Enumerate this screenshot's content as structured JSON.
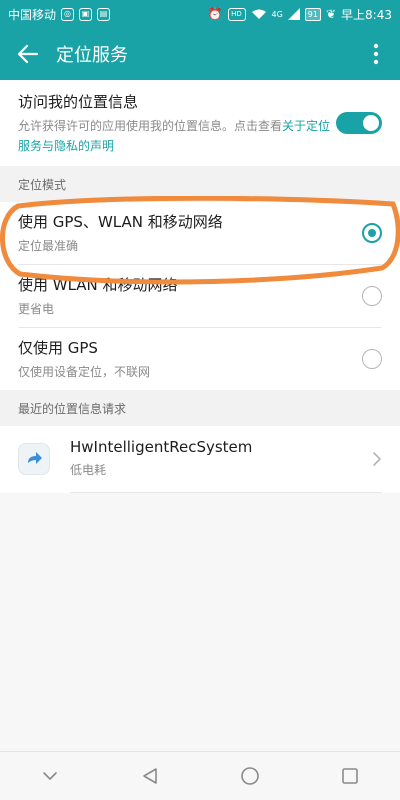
{
  "status_bar": {
    "carrier": "中国移动",
    "hd": "HD",
    "signal_label": "4G",
    "battery": "91",
    "time": "早上8:43"
  },
  "app_bar": {
    "title": "定位服务"
  },
  "location_access": {
    "title": "访问我的位置信息",
    "description": "允许获得许可的应用使用我的位置信息。点击查看",
    "link_text": "关于定位服务与隐私的声明",
    "enabled": true
  },
  "mode_section": {
    "header": "定位模式",
    "options": [
      {
        "title": "使用 GPS、WLAN 和移动网络",
        "subtitle": "定位最准确",
        "selected": true
      },
      {
        "title": "使用 WLAN 和移动网络",
        "subtitle": "更省电",
        "selected": false
      },
      {
        "title": "仅使用 GPS",
        "subtitle": "仅使用设备定位，不联网",
        "selected": false
      }
    ]
  },
  "recent_section": {
    "header": "最近的位置信息请求",
    "apps": [
      {
        "name": "HwIntelligentRecSystem",
        "usage": "低电耗"
      }
    ]
  },
  "colors": {
    "accent": "#1aa3a6",
    "annotation": "#f08a3c"
  },
  "icons": {
    "back": "arrow-left-icon",
    "more": "more-vert-icon",
    "app": "arrow-bubble-icon",
    "chevron": "chevron-right-icon",
    "nav": [
      "collapse-icon",
      "back-triangle-icon",
      "home-circle-icon",
      "recents-square-icon"
    ]
  }
}
